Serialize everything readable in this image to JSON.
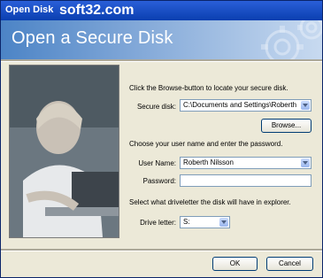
{
  "window": {
    "title": "Open Disk",
    "watermark": "soft32.com"
  },
  "banner": {
    "heading": "Open a Secure Disk"
  },
  "instructions": {
    "browse": "Click the Browse-button to locate your secure disk.",
    "credentials": "Choose your user name and enter the password.",
    "drive": "Select what driveletter the disk will have in explorer."
  },
  "form": {
    "secure_disk_label": "Secure disk:",
    "secure_disk_value": "C:\\Documents and Settings\\Roberth",
    "browse_button": "Browse...",
    "user_name_label": "User Name:",
    "user_name_value": "Roberth Nilsson",
    "password_label": "Password:",
    "password_value": "",
    "drive_letter_label": "Drive letter:",
    "drive_letter_value": "S:"
  },
  "buttons": {
    "ok": "OK",
    "cancel": "Cancel"
  },
  "colors": {
    "titlebar": "#0a3fb0",
    "banner_start": "#4c84c6",
    "banner_end": "#c8daf0",
    "dialog_bg": "#ece9d8",
    "button_border": "#003c74"
  }
}
